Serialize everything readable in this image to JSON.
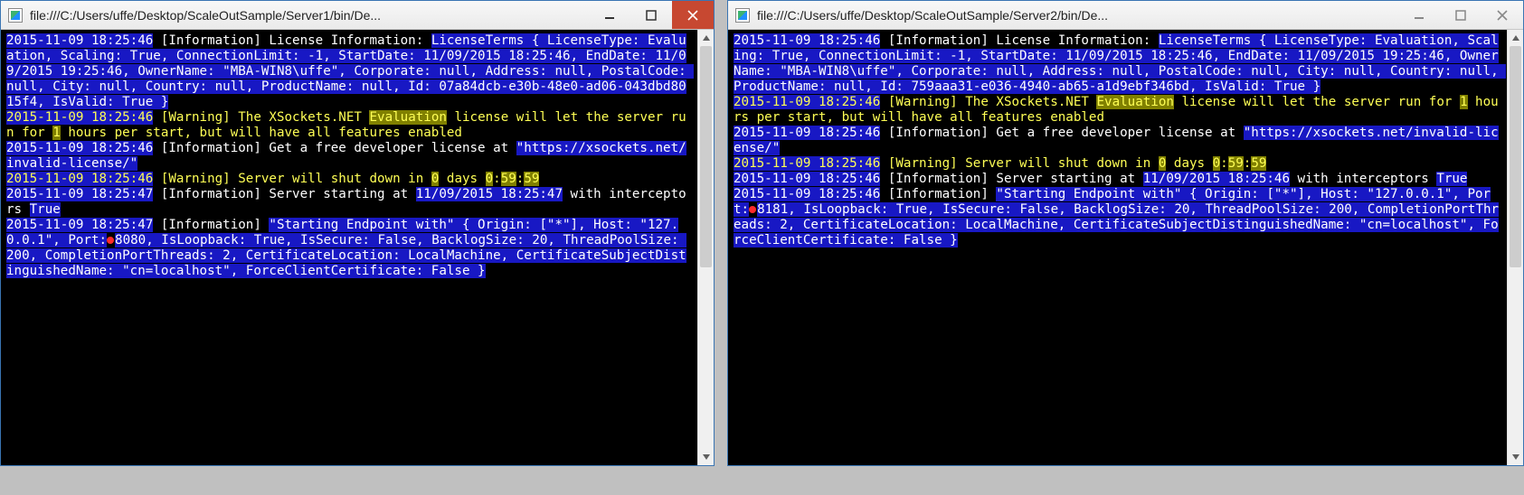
{
  "windows": [
    {
      "id": "server1",
      "title": "file:///C:/Users/uffe/Desktop/ScaleOutSample/Server1/bin/De...",
      "close_active": true,
      "port": "8080",
      "license_id": "07a84dcb-e30b-48e0-ad06-043dbd8015f4",
      "ts_info1": "2015-11-09 18:25:46",
      "ts_warn1": "2015-11-09 18:25:46",
      "ts_info2": "2015-11-09 18:25:46",
      "ts_warn2": "2015-11-09 18:25:46",
      "ts_start": "2015-11-09 18:25:47",
      "server_start_stamp": "11/09/2015 18:25:47",
      "ts_endpoint": "2015-11-09 18:25:47"
    },
    {
      "id": "server2",
      "title": "file:///C:/Users/uffe/Desktop/ScaleOutSample/Server2/bin/De...",
      "close_active": false,
      "port": "8181",
      "license_id": "759aaa31-e036-4940-ab65-a1d9ebf346bd",
      "ts_info1": "2015-11-09 18:25:46",
      "ts_warn1": "2015-11-09 18:25:46",
      "ts_info2": "2015-11-09 18:25:46",
      "ts_warn2": "2015-11-09 18:25:46",
      "ts_start": "2015-11-09 18:25:46",
      "server_start_stamp": "11/09/2015 18:25:46",
      "ts_endpoint": "2015-11-09 18:25:46"
    }
  ],
  "shared": {
    "lic_header": "License Information:",
    "license_terms_a": "LicenseTerms { LicenseType: Evaluation, Scaling: True, ConnectionLimit: -1, StartDate: 11/09/2015 18:25:46, EndDate: 11/09/2015 19:25:46, OwnerName: \"MBA-WIN8\\uffe\", Corporate: null, Address: null, PostalCode: null, City: null, Country: null, ProductName: null, Id: ",
    "license_terms_b": ", IsValid: True }",
    "warn1_a": "The XSockets.NET ",
    "warn1_eval": "Evaluation",
    "warn1_b": " license will let the server run for ",
    "warn1_hours": "1",
    "warn1_c": " hours per start, but will have all features enabled",
    "info2_a": "Get a free developer license at ",
    "info2_url": "\"https://xsockets.net/invalid-license/\"",
    "warn2_a": "Server will shut down in ",
    "warn2_days": "0",
    "warn2_b": " days ",
    "warn2_h": "0",
    "warn2_m": "59",
    "warn2_s": "59",
    "start_a": "Server starting at ",
    "start_b": " with interceptors ",
    "start_true": "True",
    "endpoint_label": "\"Starting Endpoint with\"",
    "endpoint_a": " { Origin: [\"*\"], Host: \"127.0.0.1\", Port:",
    "endpoint_b": ", IsLoopback: True, IsSecure: False, BacklogSize: 20, ThreadPoolSize: 200, CompletionPortThreads: 2, CertificateLocation: LocalMachine, CertificateSubjectDistinguishedName: \"cn=localhost\", ForceClientCertificate: False }",
    "tag_info": " [Information] ",
    "tag_warn": " [Warning] ",
    "thumb_top_frac": 0.0,
    "thumb_h_frac": 0.55
  }
}
